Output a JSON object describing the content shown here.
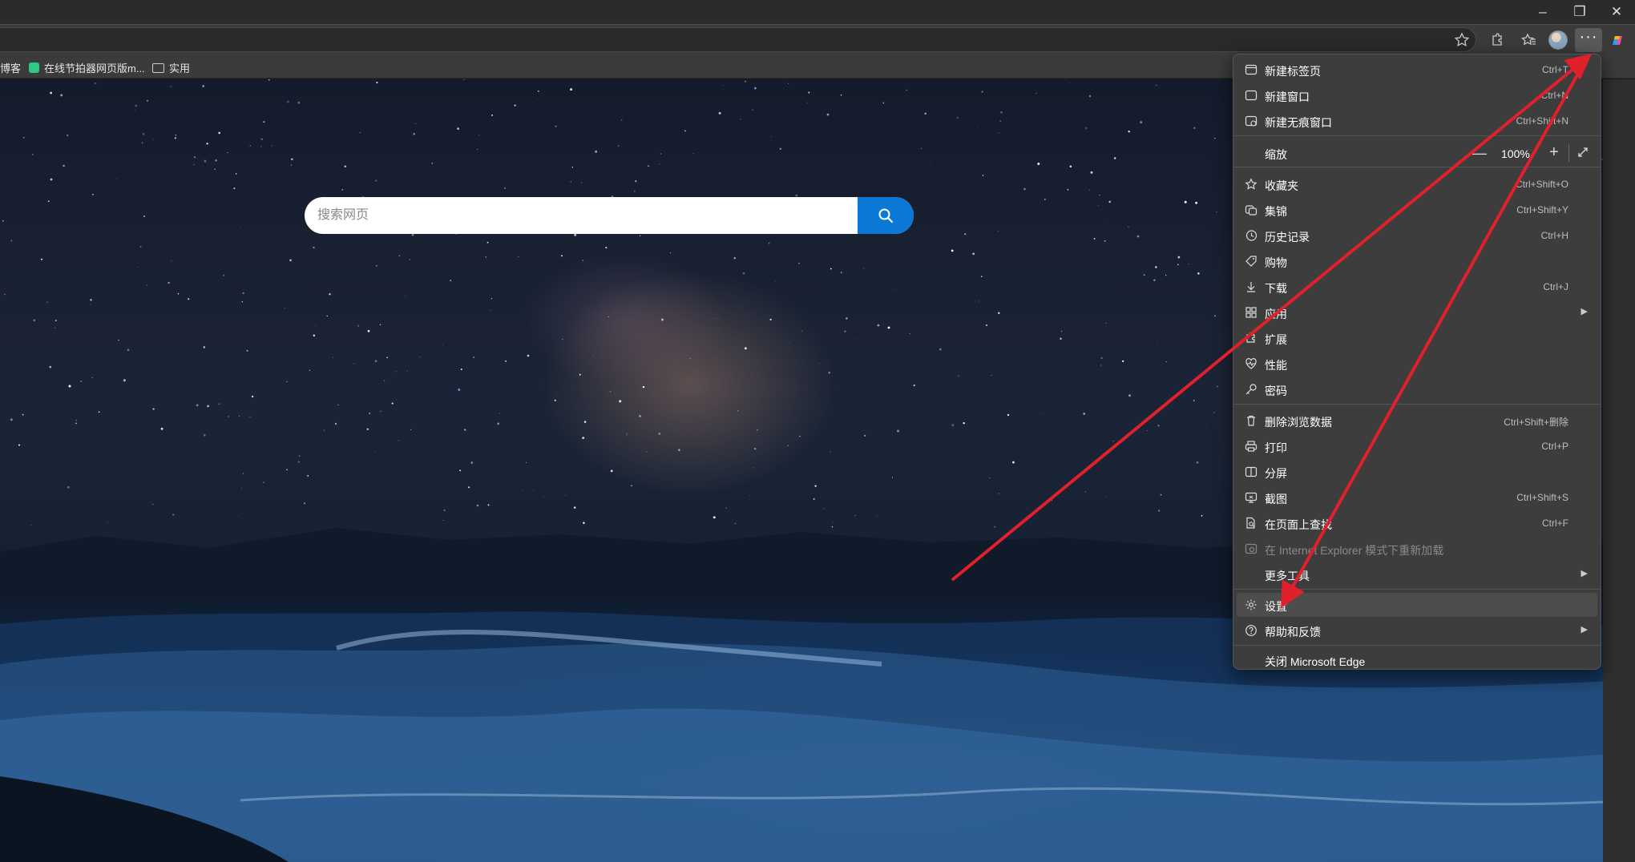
{
  "window": {
    "min_label": "–",
    "max_label": "❐",
    "close_label": "✕"
  },
  "toolbar": {
    "icons": [
      "favorite-star-icon",
      "extensions-icon",
      "favorites-icon",
      "profile-avatar",
      "more-options-icon",
      "copilot-icon"
    ]
  },
  "bookmarks": {
    "items": [
      {
        "label": "博客"
      },
      {
        "label": "在线节拍器网页版m..."
      },
      {
        "label": "实用"
      }
    ]
  },
  "search": {
    "placeholder": "搜索网页"
  },
  "menu": {
    "items": [
      {
        "label": "新建标签页",
        "shortcut": "Ctrl+T",
        "icon": "new-tab-icon"
      },
      {
        "label": "新建窗口",
        "shortcut": "Ctrl+N",
        "icon": "new-window-icon"
      },
      {
        "label": "新建无痕窗口",
        "shortcut": "Ctrl+Shift+N",
        "icon": "inprivate-window-icon"
      },
      {
        "label": "缩放",
        "zoom_value": "100%"
      },
      {
        "label": "收藏夹",
        "shortcut": "Ctrl+Shift+O",
        "icon": "favorites-icon"
      },
      {
        "label": "集锦",
        "shortcut": "Ctrl+Shift+Y",
        "icon": "collections-icon"
      },
      {
        "label": "历史记录",
        "shortcut": "Ctrl+H",
        "icon": "history-icon"
      },
      {
        "label": "购物",
        "icon": "shopping-tag-icon"
      },
      {
        "label": "下载",
        "shortcut": "Ctrl+J",
        "icon": "download-icon"
      },
      {
        "label": "应用",
        "icon": "apps-icon"
      },
      {
        "label": "扩展",
        "icon": "extensions-icon"
      },
      {
        "label": "性能",
        "icon": "performance-icon"
      },
      {
        "label": "密码",
        "icon": "password-key-icon"
      },
      {
        "label": "删除浏览数据",
        "shortcut": "Ctrl+Shift+删除",
        "icon": "delete-trash-icon"
      },
      {
        "label": "打印",
        "shortcut": "Ctrl+P",
        "icon": "print-icon"
      },
      {
        "label": "分屏",
        "icon": "split-screen-icon"
      },
      {
        "label": "截图",
        "shortcut": "Ctrl+Shift+S",
        "icon": "screenshot-icon"
      },
      {
        "label": "在页面上查找",
        "shortcut": "Ctrl+F",
        "icon": "find-on-page-icon"
      },
      {
        "label": "在 Internet Explorer 模式下重新加载",
        "icon": "ie-mode-icon"
      },
      {
        "label": "更多工具"
      },
      {
        "label": "设置",
        "icon": "settings-gear-icon"
      },
      {
        "label": "帮助和反馈",
        "icon": "help-icon"
      },
      {
        "label": "关闭 Microsoft Edge"
      }
    ]
  },
  "colors": {
    "menu_bg": "#3d3d3d",
    "search_button": "#0a78d4",
    "annotation_arrow": "#e0202a"
  }
}
